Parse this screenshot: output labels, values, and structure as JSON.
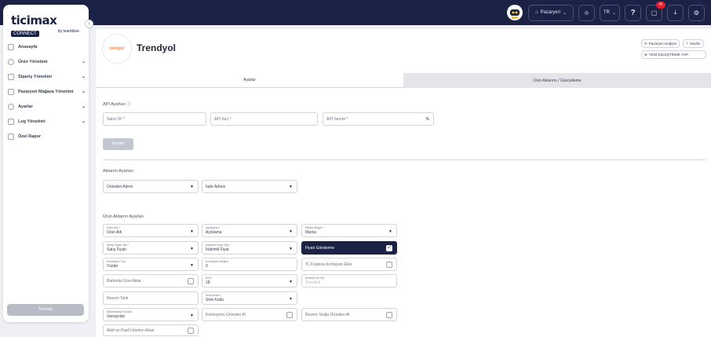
{
  "topbar": {
    "marketplace_label": "Pazaryeri",
    "language": "TR",
    "help": "?",
    "notification_count": "41"
  },
  "brand": {
    "name": "ticimax",
    "badge": "CONNECT",
    "sub": "by teamblue"
  },
  "sidebar": {
    "items": [
      {
        "label": "Anasayfa",
        "chevron": false
      },
      {
        "label": "Ürün Yönetimi",
        "chevron": true
      },
      {
        "label": "Sipariş Yönetimi",
        "chevron": true
      },
      {
        "label": "Pazaryeri Mağaza Yönetimi",
        "chevron": true
      },
      {
        "label": "Ayarlar",
        "chevron": true
      },
      {
        "label": "Log Yönetimi",
        "chevron": true
      },
      {
        "label": "Özel Rapor",
        "chevron": false
      }
    ],
    "clear_button": "Temizle"
  },
  "store": {
    "logo_text": "trendyol",
    "title": "Trendyol",
    "change_marketplace": "Pazaryeri Değiştir",
    "help": "Yardım",
    "new_matching": "YENİ EŞLEŞTİRME YAP"
  },
  "tabs": {
    "settings": "Ayarlar",
    "product_transfer": "Ürün Aktarımı / Güncelleme"
  },
  "api": {
    "heading": "API Ayarları",
    "seller_id": "Satıcı ID *",
    "api_key": "API Key *",
    "api_secret": "API Secret *",
    "percent": "%",
    "save": "Kaydet"
  },
  "transfer": {
    "heading": "Aktarım Ayarları",
    "field1": "Üründen Adres",
    "field2": "İade Adresi"
  },
  "product": {
    "heading": "Ürün Aktarım Ayarları",
    "urun_adi_label": "Ürün Adı *",
    "urun_adi_value": "Ürün Adı",
    "aciklama_label": "Açıklama *",
    "aciklama_value": "Açıklama",
    "marka_label": "Marka Bilgisi *",
    "marka_value": "Marka",
    "satis_label": "Satış Fiyatı Tipi *",
    "satis_value": "Satış Fiyatı",
    "indirimli_label": "İndirimli Fiyat Tipi *",
    "indirimli_value": "İndirimli Fiyat",
    "fiyati_gonderme": "Fiyatı Gönderme",
    "komisyon_tipi_label": "Komisyon Tipi",
    "komisyon_tipi_value": "Yüzde",
    "komisyon_deger_label": "Komisyon Değeri",
    "komisyon_deger_value": "0",
    "tl_fiyatina": "TL Fiyatına Komisyon Ekle",
    "barkod_gore": "Barkoda Göre Aktar",
    "kdv_label": "KDV",
    "kdv_value": "18",
    "barkod_on_ek_label": "Barkod Ön Ek",
    "barkod_on_ek_value": "Trendyol",
    "rezerv_stok": "Rezerv Stok",
    "stok_kodu_label": "Stok Kodu *",
    "stok_kodu_value": "Stok Kodu",
    "marketplace_grubu_label": "Marketplace Grubu",
    "marketplace_grubu_value": "Varsayılan",
    "komisyonu_urunden": "Komisyonu Üründen Al",
    "rezerv_stogu": "Rezerv Stoğu Üründen Al",
    "aktif_pasif": "Aktif ve Pasif Ürünleri Aktar"
  }
}
